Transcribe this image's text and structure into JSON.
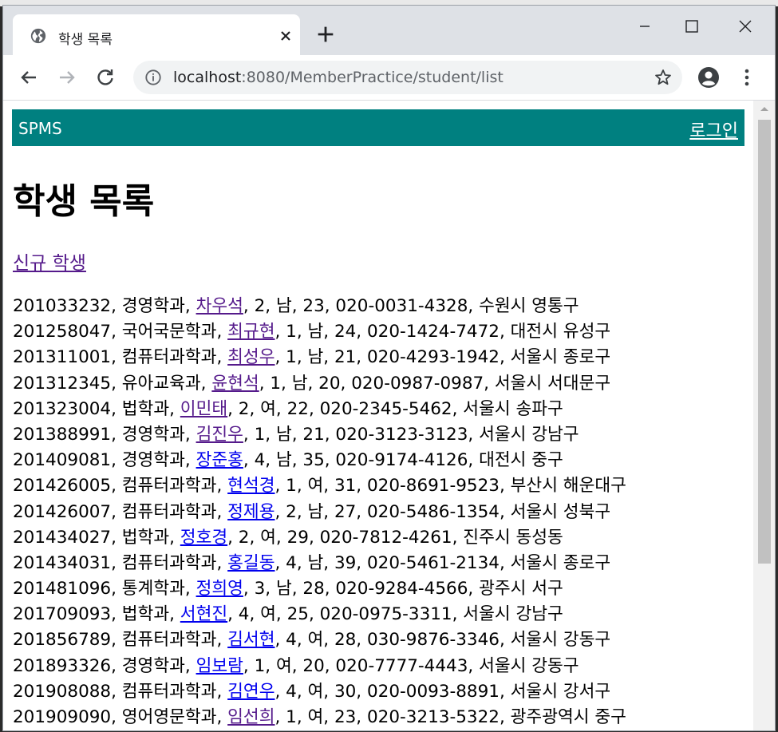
{
  "browser": {
    "tab_title": "학생 목록",
    "url_host": "localhost",
    "url_rest": ":8080/MemberPractice/student/list"
  },
  "page": {
    "brand": "SPMS",
    "login_label": "로그인",
    "title": "학생 목록",
    "new_student_link": "신규 학생"
  },
  "students": [
    {
      "pre": "201033232, 경영학과, ",
      "name": "차우석",
      "post": ", 2, 남, 23, 020-0031-4328, 수원시 영통구",
      "visited": true
    },
    {
      "pre": "201258047, 국어국문학과, ",
      "name": "최규현",
      "post": ", 1, 남, 24, 020-1424-7472, 대전시 유성구",
      "visited": true
    },
    {
      "pre": "201311001, 컴퓨터과학과, ",
      "name": "최성우",
      "post": ", 1, 남, 21, 020-4293-1942, 서울시 종로구",
      "visited": true
    },
    {
      "pre": "201312345, 유아교육과, ",
      "name": "윤현석",
      "post": ", 1, 남, 20, 020-0987-0987, 서울시 서대문구",
      "visited": true
    },
    {
      "pre": "201323004, 법학과, ",
      "name": "이민태",
      "post": ", 2, 여, 22, 020-2345-5462, 서울시 송파구",
      "visited": true
    },
    {
      "pre": "201388991, 경영학과, ",
      "name": "김진우",
      "post": ", 1, 남, 21, 020-3123-3123, 서울시 강남구",
      "visited": true
    },
    {
      "pre": "201409081, 경영학과, ",
      "name": "장준홍",
      "post": ", 4, 남, 35, 020-9174-4126, 대전시 중구",
      "visited": false
    },
    {
      "pre": "201426005, 컴퓨터과학과, ",
      "name": "현석경",
      "post": ", 1, 여, 31, 020-8691-9523, 부산시 해운대구",
      "visited": false
    },
    {
      "pre": "201426007, 컴퓨터과학과, ",
      "name": "정제용",
      "post": ", 2, 남, 27, 020-5486-1354, 서울시 성북구",
      "visited": false
    },
    {
      "pre": "201434027, 법학과, ",
      "name": "정호경",
      "post": ", 2, 여, 29, 020-7812-4261, 진주시 동성동",
      "visited": false
    },
    {
      "pre": "201434031, 컴퓨터과학과, ",
      "name": "홍길동",
      "post": ", 4, 남, 39, 020-5461-2134, 서울시 종로구",
      "visited": false
    },
    {
      "pre": "201481096, 통계학과, ",
      "name": "정희영",
      "post": ", 3, 남, 28, 020-9284-4566, 광주시 서구",
      "visited": false
    },
    {
      "pre": "201709093, 법학과, ",
      "name": "서현진",
      "post": ", 4, 여, 25, 020-0975-3311, 서울시 강남구",
      "visited": false
    },
    {
      "pre": "201856789, 컴퓨터과학과, ",
      "name": "김서현",
      "post": ", 4, 여, 28, 030-9876-3346, 서울시 강동구",
      "visited": false
    },
    {
      "pre": "201893326, 경영학과, ",
      "name": "임보람",
      "post": ", 1, 여, 20, 020-7777-4443, 서울시 강동구",
      "visited": false
    },
    {
      "pre": "201908088, 컴퓨터과학과, ",
      "name": "김연우",
      "post": ", 4, 여, 30, 020-0093-8891, 서울시 강서구",
      "visited": false
    },
    {
      "pre": "201909090, 영어영문학과, ",
      "name": "임선희",
      "post": ", 1, 여, 23, 020-3213-5322, 광주광역시 중구",
      "visited": true
    }
  ],
  "colors": {
    "header_bg": "#008080",
    "link_visited": "#551a8b",
    "link_unvisited": "#0000ee"
  }
}
